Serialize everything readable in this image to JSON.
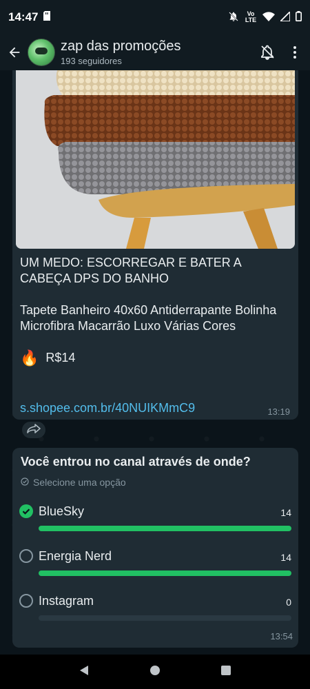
{
  "status_bar": {
    "time": "14:47",
    "volte_label": "Vo LTE",
    "icons": [
      "sd-card-icon",
      "notifications-muted-icon",
      "volte-icon",
      "wifi-icon",
      "signal-icon",
      "battery-icon"
    ]
  },
  "header": {
    "title": "zap das promoções",
    "subtitle": "193 seguidores",
    "icons": [
      "back-arrow-icon",
      "mute-bell-icon",
      "more-vertical-icon"
    ]
  },
  "message": {
    "heading": "UM MEDO: ESCORREGAR E BATER A CABEÇA DPS DO BANHO",
    "description": "Tapete Banheiro 40x60 Antiderrapante Bolinha Microfibra Macarrão Luxo Várias Cores",
    "price_emoji": "🔥",
    "price": "R$14",
    "link": "s.shopee.com.br/40NUIKMmC9",
    "time": "13:19",
    "image_description_icon": "product-photo"
  },
  "forward_icon": "forward-icon",
  "poll": {
    "question": "Você entrou no canal através de onde?",
    "hint": "Selecione uma opção",
    "time": "13:54",
    "options": [
      {
        "label": "BlueSky",
        "count": "14",
        "selected": true,
        "fraction": 1.0
      },
      {
        "label": "Energia Nerd",
        "count": "14",
        "selected": false,
        "fraction": 1.0
      },
      {
        "label": "Instagram",
        "count": "0",
        "selected": false,
        "fraction": 0.0
      }
    ]
  },
  "colors": {
    "bubble": "#1f2c34",
    "accent": "#21c063",
    "link": "#53bdeb",
    "background": "#0b141a"
  }
}
